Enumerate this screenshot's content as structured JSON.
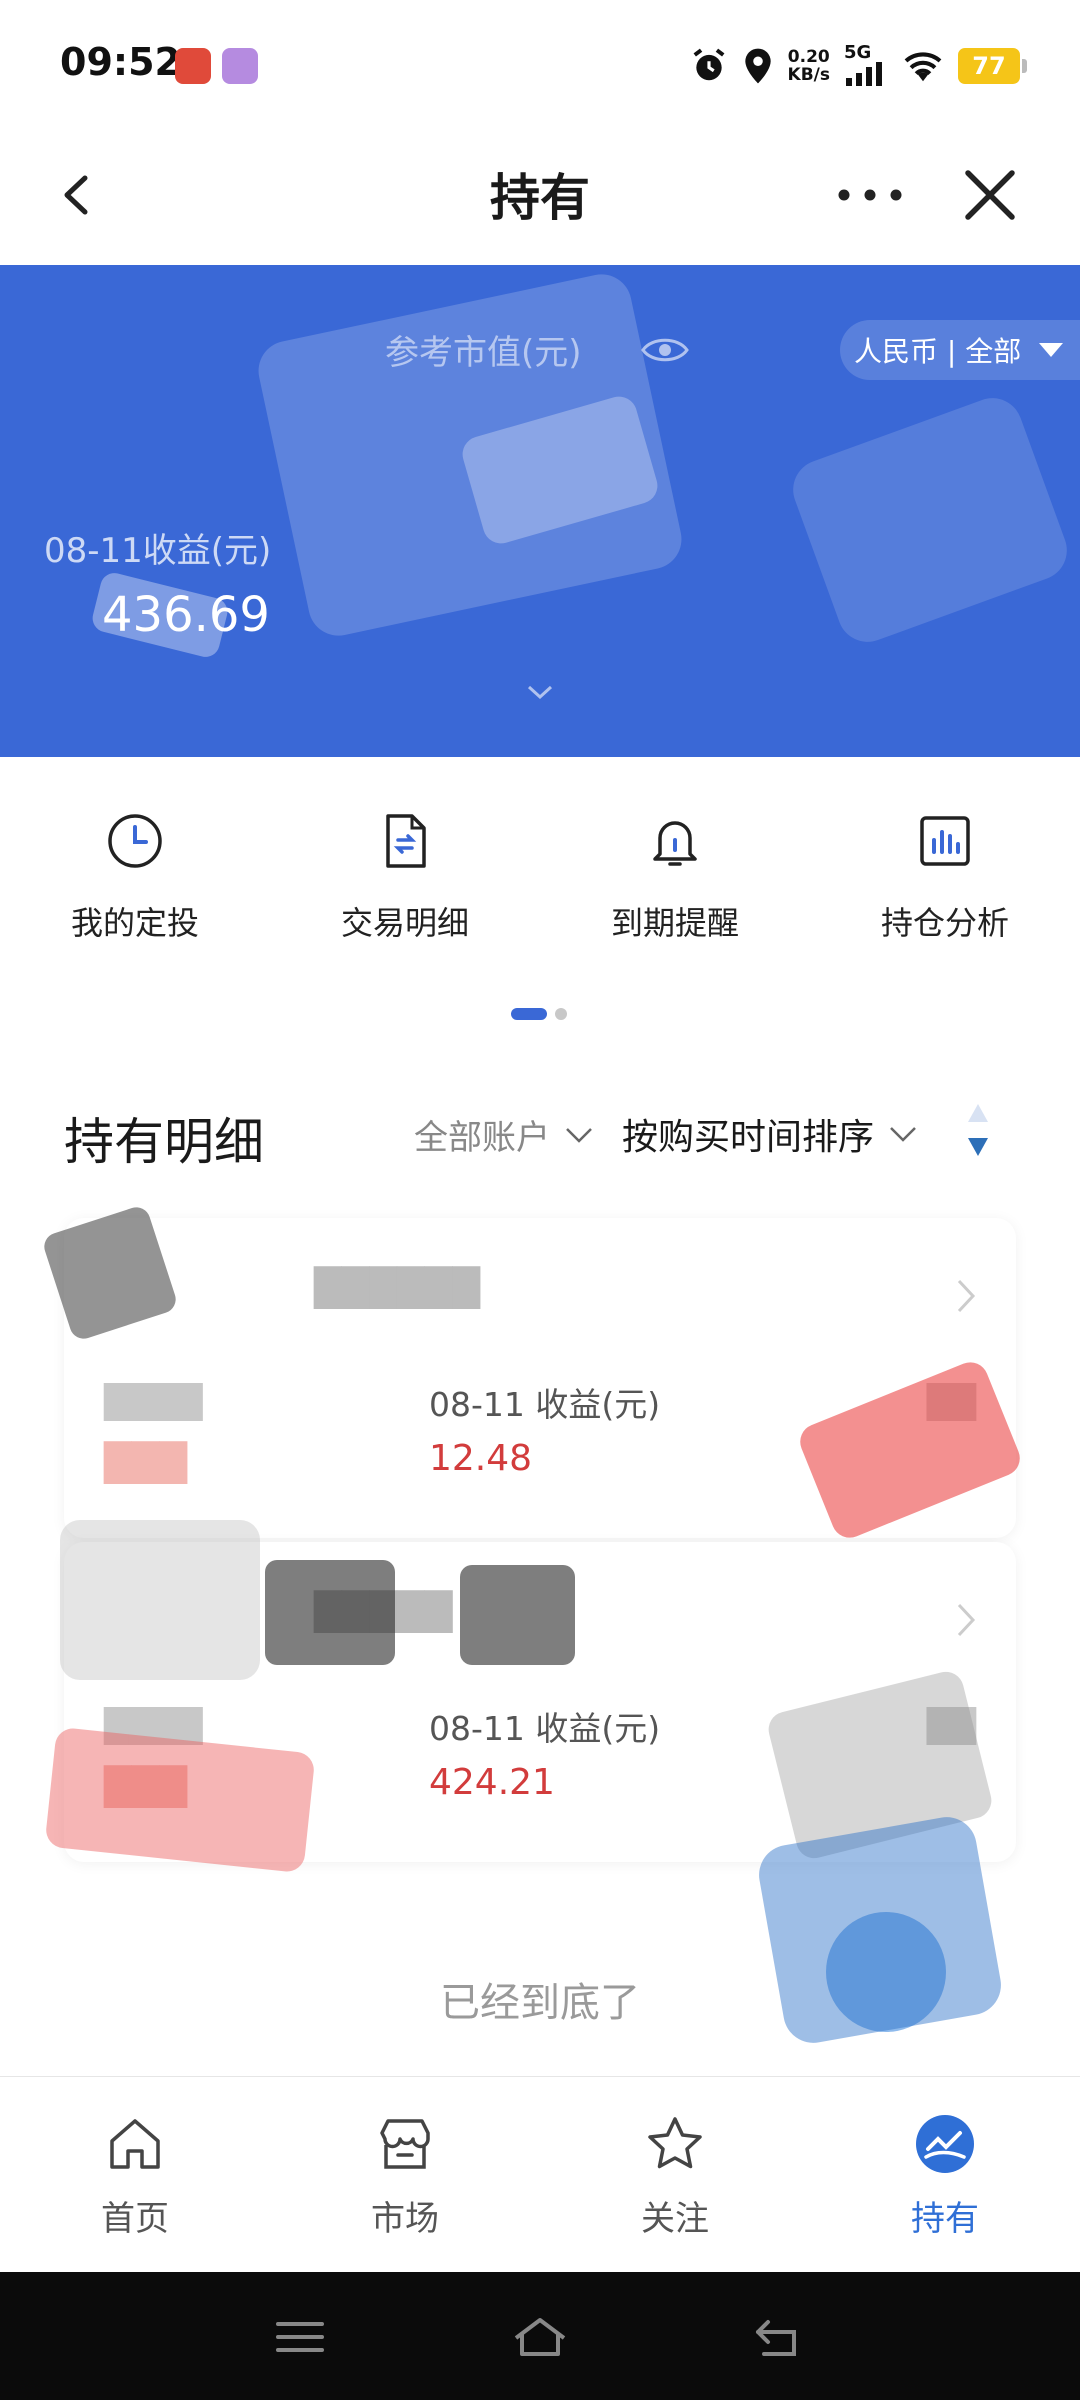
{
  "status_bar": {
    "time": "09:52",
    "speed_value": "0.20",
    "speed_unit": "KB/s",
    "network": "5G",
    "battery": "77"
  },
  "header": {
    "title": "持有"
  },
  "summary": {
    "market_value_label": "参考市值(元)",
    "currency_filter": "人民币 | 全部",
    "daily_income_label": "08-11收益(元)",
    "daily_income_value": "436.69"
  },
  "quick_actions": [
    {
      "label": "我的定投",
      "icon": "clock-icon"
    },
    {
      "label": "交易明细",
      "icon": "transaction-doc-icon"
    },
    {
      "label": "到期提醒",
      "icon": "bell-icon"
    },
    {
      "label": "持仓分析",
      "icon": "bar-chart-icon"
    }
  ],
  "holdings": {
    "title": "持有明细",
    "account_filter": "全部账户",
    "sort_filter": "按购买时间排序",
    "items": [
      {
        "daily_label": "08-11 收益(元)",
        "daily_value": "12.48"
      },
      {
        "daily_label": "08-11 收益(元)",
        "daily_value": "424.21"
      }
    ],
    "end_note": "已经到底了"
  },
  "tabbar": [
    {
      "label": "首页",
      "icon": "home-icon",
      "active": false
    },
    {
      "label": "市场",
      "icon": "market-icon",
      "active": false
    },
    {
      "label": "关注",
      "icon": "star-icon",
      "active": false
    },
    {
      "label": "持有",
      "icon": "holdings-icon",
      "active": true
    }
  ],
  "colors": {
    "accent_blue": "#3a68d6",
    "income_red": "#d23c3c",
    "tab_active": "#2f6fd6"
  }
}
